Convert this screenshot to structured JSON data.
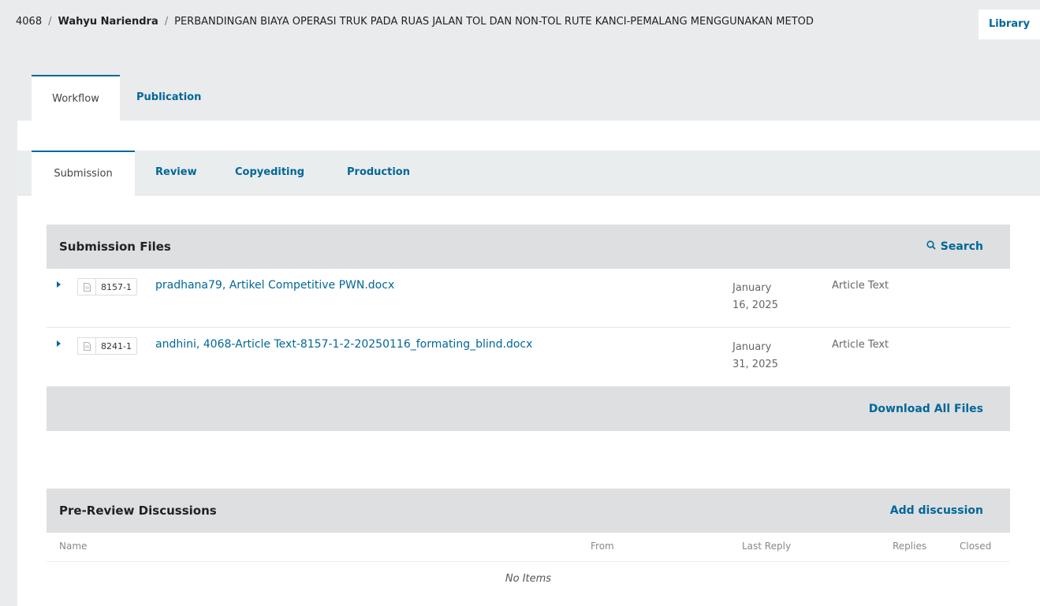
{
  "breadcrumb": {
    "id": "4068",
    "separator": "/",
    "author": "Wahyu Nariendra",
    "title": "PERBANDINGAN BIAYA OPERASI TRUK PADA RUAS JALAN TOL DAN NON-TOL RUTE KANCI-PEMALANG MENGGUNAKAN METOD"
  },
  "header": {
    "library_label": "Library"
  },
  "top_tabs": [
    {
      "label": "Workflow"
    },
    {
      "label": "Publication"
    }
  ],
  "sub_tabs": [
    {
      "label": "Submission"
    },
    {
      "label": "Review"
    },
    {
      "label": "Copyediting"
    },
    {
      "label": "Production"
    }
  ],
  "submission_files": {
    "title": "Submission Files",
    "search_label": "Search",
    "files": [
      {
        "id": "8157-1",
        "name": "pradhana79, Artikel Competitive PWN.docx",
        "date_line1": "January",
        "date_line2": "16, 2025",
        "type": "Article Text"
      },
      {
        "id": "8241-1",
        "name": "andhini, 4068-Article Text-8157-1-2-20250116_formating_blind.docx",
        "date_line1": "January",
        "date_line2": "31, 2025",
        "type": "Article Text"
      }
    ],
    "download_all_label": "Download All Files"
  },
  "discussions": {
    "title": "Pre-Review Discussions",
    "add_label": "Add discussion",
    "columns": {
      "name": "Name",
      "from": "From",
      "last_reply": "Last Reply",
      "replies": "Replies",
      "closed": "Closed"
    },
    "empty_text": "No Items"
  },
  "colors": {
    "link": "#006798",
    "header_bg": "#e9ebed",
    "grid_header_bg": "#dddfe1"
  }
}
